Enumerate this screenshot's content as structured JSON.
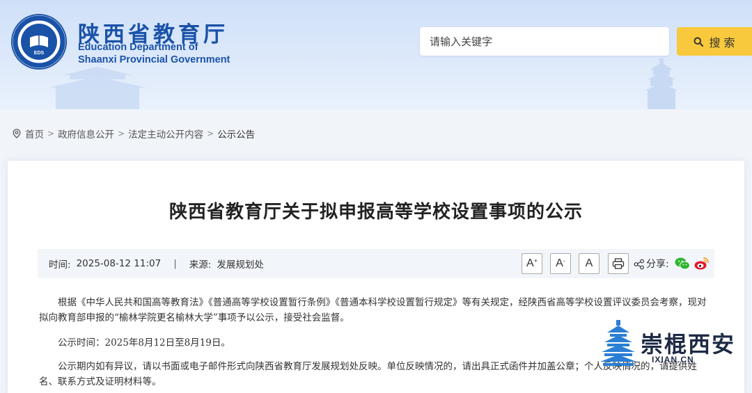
{
  "header": {
    "title_cn": "陕西省教育厅",
    "title_en_line1": "Education Department of",
    "title_en_line2": "Shaanxi Provincial Government",
    "emblem_text": "EDS",
    "search_placeholder": "请输入关键字",
    "search_button_label": "搜 索",
    "colors": {
      "brand_blue": "#1a52a8",
      "search_button": "#f8c93c",
      "header_bg": "#d6e5f9"
    }
  },
  "breadcrumb": {
    "items": [
      "首页",
      "政府信息公开",
      "法定主动公开内容",
      "公示公告"
    ],
    "separator": ">"
  },
  "article": {
    "title": "陕西省教育厅关于拟申报高等学校设置事项的公示",
    "time_label": "时间:",
    "time_value": "2025-08-12 11:07",
    "divider": "|",
    "source_label": "来源:",
    "source_value": "发展规划处",
    "font_buttons": [
      "A+",
      "A-",
      "A"
    ],
    "share_label": "分享:",
    "paragraphs": [
      "根据《中华人民共和国高等教育法》《普通高等学校设置暂行条例》《普通本科学校设置暂行规定》等有关规定，经陕西省高等学校设置评议委员会考察，现对拟向教育部申报的“榆林学院更名榆林大学”事项予以公示，接受社会监督。",
      "公示时间：2025年8月12日至8月19日。",
      "公示期内如有异议，请以书面或电子邮件形式向陕西省教育厅发展规划处反映。单位反映情况的，请出具正式函件并加盖公章；个人反映情况的，请提供姓名、联系方式及证明材料等。"
    ]
  },
  "watermark": {
    "text": "崇棍西安",
    "url": "IXIAN.CN"
  }
}
